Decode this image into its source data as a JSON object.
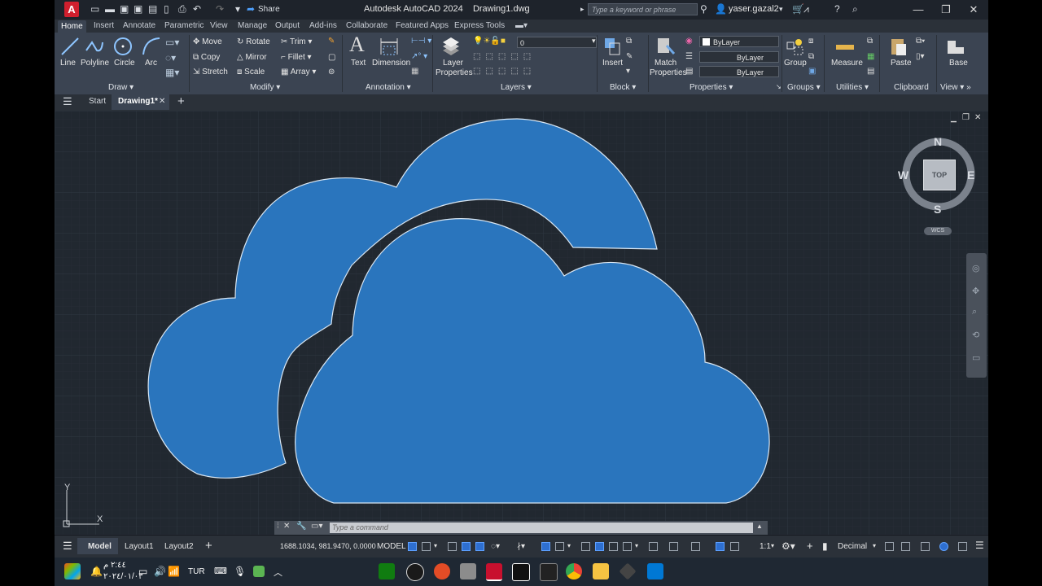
{
  "window": {
    "title": "Autodesk AutoCAD 2024",
    "file": "Drawing1.dwg",
    "app_logo": "A",
    "share_label": "Share",
    "search_placeholder": "Type a keyword or phrase",
    "user": "yaser.gazal2"
  },
  "ribbon_tabs": [
    "Home",
    "Insert",
    "Annotate",
    "Parametric",
    "View",
    "Manage",
    "Output",
    "Add-ins",
    "Collaborate",
    "Featured Apps",
    "Express Tools"
  ],
  "ribbon": {
    "draw": {
      "title": "Draw",
      "line": "Line",
      "polyline": "Polyline",
      "circle": "Circle",
      "arc": "Arc"
    },
    "modify": {
      "title": "Modify",
      "move": "Move",
      "rotate": "Rotate",
      "trim": "Trim",
      "copy": "Copy",
      "mirror": "Mirror",
      "fillet": "Fillet",
      "stretch": "Stretch",
      "scale": "Scale",
      "array": "Array"
    },
    "annotation": {
      "title": "Annotation",
      "text": "Text",
      "dimension": "Dimension"
    },
    "layers": {
      "title": "Layers",
      "layer_properties_1": "Layer",
      "layer_properties_2": "Properties",
      "current_layer": "0"
    },
    "block": {
      "title": "Block",
      "insert": "Insert"
    },
    "properties": {
      "title": "Properties",
      "match_1": "Match",
      "match_2": "Properties",
      "color": "ByLayer",
      "linetype": "ByLayer",
      "lineweight": "ByLayer"
    },
    "groups": {
      "title": "Groups",
      "group": "Group"
    },
    "utilities": {
      "title": "Utilities",
      "measure": "Measure"
    },
    "clipboard": {
      "title": "Clipboard",
      "paste": "Paste"
    },
    "view": {
      "title": "View",
      "base": "Base"
    }
  },
  "file_tabs": {
    "start": "Start",
    "drawing": "Drawing1*"
  },
  "viewcube": {
    "n": "N",
    "s": "S",
    "e": "E",
    "w": "W",
    "top": "TOP",
    "wcs": "WCS"
  },
  "ucs": {
    "x": "X",
    "y": "Y"
  },
  "command": {
    "placeholder": "Type a command"
  },
  "status": {
    "model": "Model",
    "layout1": "Layout1",
    "layout2": "Layout2",
    "coords": "1688.1034, 981.9470, 0.0000",
    "space": "MODEL",
    "scale": "1:1",
    "units": "Decimal"
  },
  "taskbar": {
    "date_line1": "٢:٤٤ م",
    "date_line2": "٢٠٢٤/٠١/٠٣",
    "lang": "TUR"
  },
  "colors": {
    "cloud": "#2a75bd",
    "cloud_stroke": "#d8e6f3",
    "canvas": "#212830",
    "grid": "#2d353f"
  }
}
